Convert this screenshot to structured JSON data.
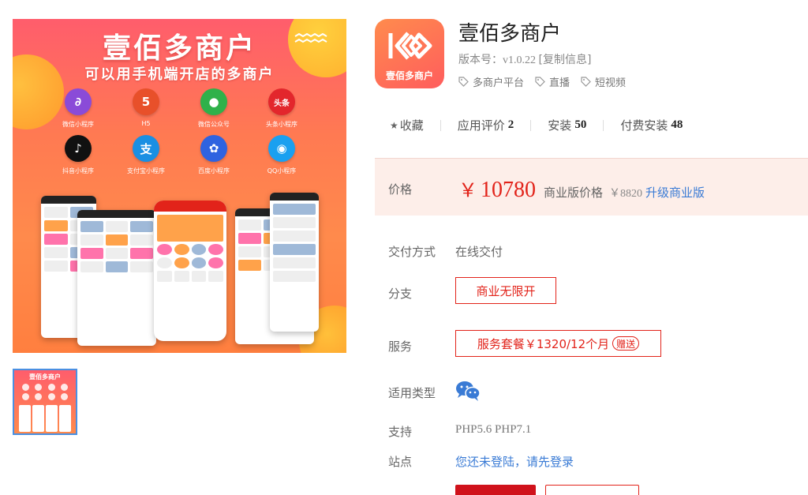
{
  "banner": {
    "title": "壹佰多商户",
    "subtitle": "可以用手机端开店的多商户",
    "platforms": [
      {
        "label": "微信小程序",
        "icon": "wechat-miniprogram-icon",
        "glyph": "∂",
        "color": "#8a4bd8"
      },
      {
        "label": "H5",
        "icon": "html5-icon",
        "glyph": "5",
        "color": "#e8502a"
      },
      {
        "label": "微信公众号",
        "icon": "wechat-official-icon",
        "glyph": "●",
        "color": "#2fb14a"
      },
      {
        "label": "头条小程序",
        "icon": "toutiao-icon",
        "glyph": "头条",
        "color": "#e3262c"
      },
      {
        "label": "抖音小程序",
        "icon": "douyin-icon",
        "glyph": "♪",
        "color": "#111111"
      },
      {
        "label": "支付宝小程序",
        "icon": "alipay-icon",
        "glyph": "支",
        "color": "#1a8fe3"
      },
      {
        "label": "百度小程序",
        "icon": "baidu-icon",
        "glyph": "✿",
        "color": "#2f63e0"
      },
      {
        "label": "QQ小程序",
        "icon": "qq-icon",
        "glyph": "◉",
        "color": "#1aa0f0"
      }
    ]
  },
  "thumbnail": {
    "title": "壹佰多商户"
  },
  "app": {
    "icon_label": "壹佰多商户",
    "name": "壹佰多商户",
    "version_label": "版本号：",
    "version": "v1.0.22",
    "copy_label": "[复制信息]",
    "tags": [
      "多商户平台",
      "直播",
      "短视频"
    ]
  },
  "stats": {
    "favorite_label": "收藏",
    "rating_label": "应用评价",
    "rating_count": "2",
    "install_label": "安装",
    "install_count": "50",
    "paid_install_label": "付费安装",
    "paid_install_count": "48"
  },
  "price": {
    "label": "价格",
    "currency": "￥",
    "amount": "10780",
    "biz_label": "商业版价格",
    "biz_price": "￥8820",
    "upgrade_label": "升级商业版"
  },
  "details": {
    "delivery_label": "交付方式",
    "delivery_value": "在线交付",
    "branch_label": "分支",
    "branch_option": "商业无限开",
    "service_label": "服务",
    "service_option": "服务套餐￥1320/12个月",
    "gift_label": "赠送",
    "type_label": "适用类型",
    "support_label": "支持",
    "support_value": "PHP5.6 PHP7.1",
    "site_label": "站点",
    "site_value": "您还未登陆，请先登录"
  },
  "colors": {
    "accent": "#e2231a",
    "link": "#3a7bd5",
    "price_bg": "#fdeee9"
  }
}
